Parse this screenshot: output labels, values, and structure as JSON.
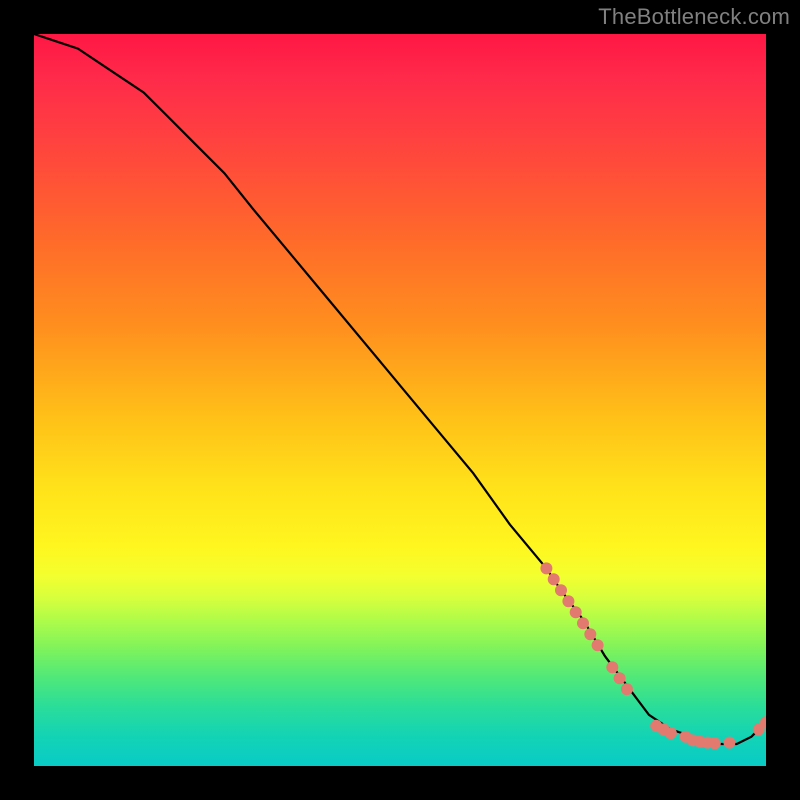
{
  "watermark": "TheBottleneck.com",
  "chart_data": {
    "type": "line",
    "title": "",
    "xlabel": "",
    "ylabel": "",
    "xlim": [
      0,
      100
    ],
    "ylim": [
      0,
      100
    ],
    "series": [
      {
        "name": "curve",
        "color": "#000000",
        "x": [
          0,
          3,
          6,
          9,
          12,
          15,
          18,
          22,
          26,
          30,
          35,
          40,
          45,
          50,
          55,
          60,
          65,
          70,
          72,
          75,
          78,
          81,
          84,
          87,
          90,
          93,
          96,
          98,
          100
        ],
        "y": [
          100,
          99,
          98,
          96,
          94,
          92,
          89,
          85,
          81,
          76,
          70,
          64,
          58,
          52,
          46,
          40,
          33,
          27,
          24,
          20,
          15,
          11,
          7,
          5,
          4,
          3,
          3,
          4,
          6
        ]
      }
    ],
    "markers": {
      "name": "highlighted-points",
      "color": "#e27a70",
      "radius_px": 6,
      "points": [
        {
          "x": 70,
          "y": 27
        },
        {
          "x": 71,
          "y": 25.5
        },
        {
          "x": 72,
          "y": 24
        },
        {
          "x": 73,
          "y": 22.5
        },
        {
          "x": 74,
          "y": 21
        },
        {
          "x": 75,
          "y": 19.5
        },
        {
          "x": 76,
          "y": 18
        },
        {
          "x": 77,
          "y": 16.5
        },
        {
          "x": 79,
          "y": 13.5
        },
        {
          "x": 80,
          "y": 12
        },
        {
          "x": 81,
          "y": 10.5
        },
        {
          "x": 85,
          "y": 5.5
        },
        {
          "x": 86,
          "y": 5
        },
        {
          "x": 87,
          "y": 4.5
        },
        {
          "x": 89,
          "y": 4
        },
        {
          "x": 90,
          "y": 3.5
        },
        {
          "x": 91,
          "y": 3.3
        },
        {
          "x": 92,
          "y": 3.2
        },
        {
          "x": 93,
          "y": 3.1
        },
        {
          "x": 95,
          "y": 3.2
        },
        {
          "x": 99,
          "y": 5
        },
        {
          "x": 100,
          "y": 6
        }
      ]
    }
  }
}
